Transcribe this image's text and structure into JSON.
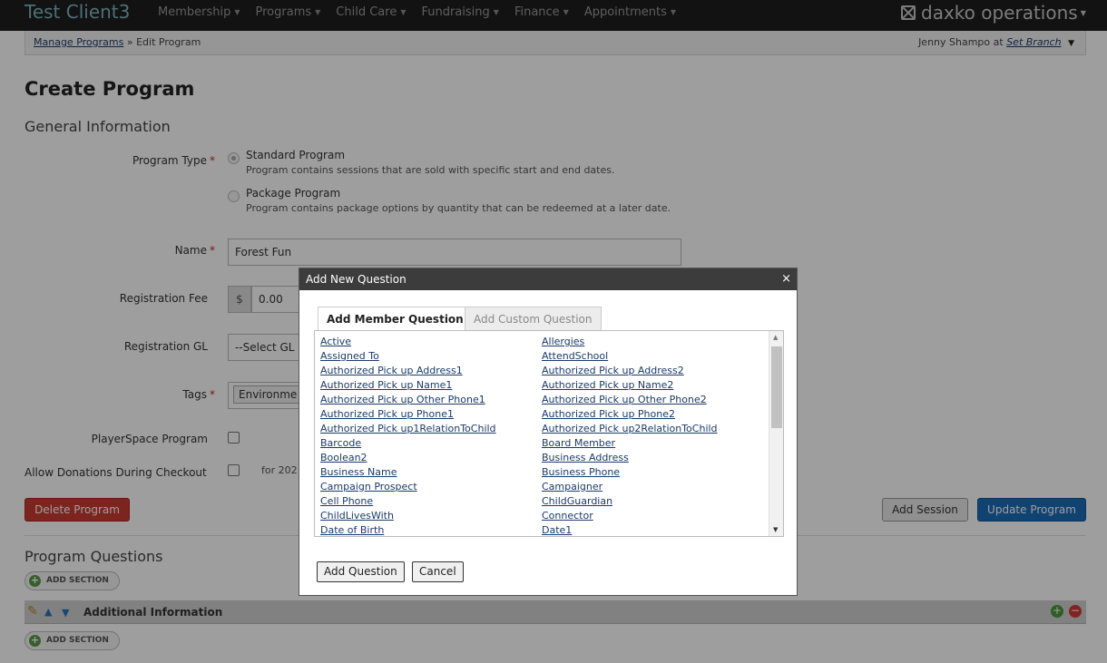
{
  "app": {
    "client_name": "Test Client3",
    "logo_text": "daxko operations"
  },
  "nav": {
    "items": [
      "Membership",
      "Programs",
      "Child Care",
      "Fundraising",
      "Finance",
      "Appointments"
    ]
  },
  "breadcrumb": {
    "link": "Manage Programs",
    "separator": "»",
    "current": "Edit Program"
  },
  "user": {
    "text": "Jenny Shampo at",
    "branch_link": "Set Branch"
  },
  "page": {
    "title": "Create Program",
    "section_general": "General Information",
    "section_questions": "Program Questions"
  },
  "form": {
    "program_type_label": "Program Type",
    "required_mark": "*",
    "standard_title": "Standard Program",
    "standard_desc": "Program contains sessions that are sold with specific start and end dates.",
    "package_title": "Package Program",
    "package_desc": "Program contains package options by quantity that can be redeemed at a later date.",
    "name_label": "Name",
    "name_value": "Forest Fun",
    "fee_label": "Registration Fee",
    "fee_addon": "$",
    "fee_value": "0.00",
    "gl_label": "Registration GL",
    "gl_value": "--Select GL",
    "tags_label": "Tags",
    "tags_value": "Environme",
    "playerspace_label": "PlayerSpace Program",
    "donations_label": "Allow Donations During Checkout",
    "donations_note": "for 202"
  },
  "buttons": {
    "delete_program": "Delete Program",
    "add_session": "Add Session",
    "update_program": "Update Program",
    "add_section": "ADD SECTION"
  },
  "section_bar": {
    "title": "Additional Information"
  },
  "dialog": {
    "title": "Add New Question",
    "close": "×",
    "tab_member": "Add Member Question",
    "tab_custom": "Add Custom Question",
    "questions_left": [
      "Active",
      "Assigned To",
      "Authorized Pick up Address1",
      "Authorized Pick up Name1",
      "Authorized Pick up Other Phone1",
      "Authorized Pick up Phone1",
      "Authorized Pick up1RelationToChild",
      "Barcode",
      "Boolean2",
      "Business Name",
      "Campaign Prospect",
      "Cell Phone",
      "ChildLivesWith",
      "Date of Birth"
    ],
    "questions_right": [
      "Allergies",
      "AttendSchool",
      "Authorized Pick up Address2",
      "Authorized Pick up Name2",
      "Authorized Pick up Other Phone2",
      "Authorized Pick up Phone2",
      "Authorized Pick up2RelationToChild",
      "Board Member",
      "Business Address",
      "Business Phone",
      "Campaigner",
      "ChildGuardian",
      "Connector",
      "Date1"
    ],
    "add_button": "Add Question",
    "cancel_button": "Cancel"
  }
}
